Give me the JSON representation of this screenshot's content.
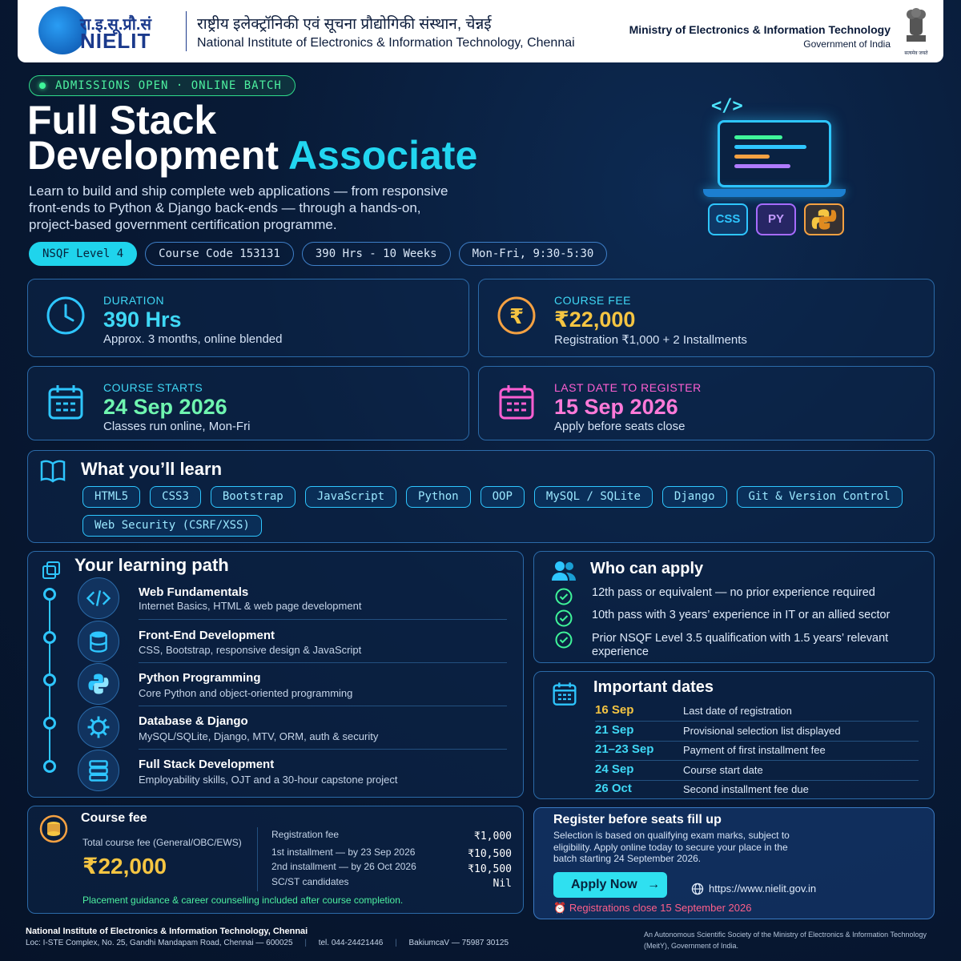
{
  "header": {
    "logo_devanagari": "रा.इ.सू.प्रौ.सं",
    "logo_word": "NIELIT",
    "title_hindi": "राष्ट्रीय इलेक्ट्रॉनिकी एवं सूचना प्रौद्योगिकी संस्थान, चेन्नई",
    "title_english": "National Institute of Electronics & Information Technology, Chennai",
    "ministry": "Ministry of Electronics & Information Technology",
    "government": "Government of India",
    "emblem_motto": "सत्यमेव जयते"
  },
  "hero": {
    "admissions": "ADMISSIONS OPEN · ONLINE BATCH",
    "title_line1": "Full Stack",
    "title_line2": "Development",
    "title_accent": "Associate",
    "intro": "Learn to build and ship complete web applications — from responsive front-ends to Python & Django back-ends — through a hands-on, project-based government certification programme.",
    "chips": [
      "NSQF Level 4",
      "Course Code  153131",
      "390 Hrs  -  10 Weeks",
      "Mon-Fri,  9:30-5:30"
    ],
    "code_symbol": "</>",
    "badges": [
      "CSS",
      "PY"
    ]
  },
  "stats": {
    "duration": {
      "label": "DURATION",
      "value": "390 Hrs",
      "sub": "Approx. 3 months, online blended"
    },
    "fee": {
      "label": "COURSE FEE",
      "value": "₹22,000",
      "sub": "Registration ₹1,000 + 2 Installments",
      "symbol": "₹"
    },
    "starts": {
      "label": "COURSE STARTS",
      "value": "24 Sep 2026",
      "sub": "Classes run online, Mon-Fri"
    },
    "last_date": {
      "label": "LAST DATE TO REGISTER",
      "value": "15 Sep 2026",
      "sub": "Apply before seats close"
    }
  },
  "learn": {
    "title": "What you’ll learn",
    "skills": [
      "HTML5",
      "CSS3",
      "Bootstrap",
      "JavaScript",
      "Python",
      "OOP",
      "MySQL / SQLite",
      "Django",
      "Git & Version Control",
      "Web Security (CSRF/XSS)"
    ]
  },
  "path": {
    "title": "Your learning path",
    "steps": [
      {
        "title": "Web Fundamentals",
        "desc": "Internet Basics, HTML & web page development",
        "icon": "code-icon"
      },
      {
        "title": "Front-End Development",
        "desc": "CSS, Bootstrap, responsive design & JavaScript",
        "icon": "database-icon"
      },
      {
        "title": "Python Programming",
        "desc": "Core Python and object-oriented programming",
        "icon": "python-icon"
      },
      {
        "title": "Database & Django",
        "desc": "MySQL/SQLite, Django, MTV, ORM, auth & security",
        "icon": "gear-icon"
      },
      {
        "title": "Full Stack Development",
        "desc": "Employability skills, OJT and a 30-hour capstone project",
        "icon": "server-icon"
      }
    ]
  },
  "apply": {
    "title": "Who can apply",
    "items": [
      "12th pass or equivalent — no prior experience required",
      "10th pass with 3 years’ experience in IT or an allied sector",
      "Prior NSQF Level 3.5 qualification with 1.5 years’ relevant experience"
    ]
  },
  "dates": {
    "title": "Important dates",
    "rows": [
      {
        "day": "16 Sep",
        "event": "Last date of registration"
      },
      {
        "day": "21 Sep",
        "event": "Provisional selection list displayed"
      },
      {
        "day": "21–23 Sep",
        "event": "Payment of first installment fee"
      },
      {
        "day": "24 Sep",
        "event": "Course start date"
      },
      {
        "day": "26 Oct",
        "event": "Second installment fee due"
      }
    ]
  },
  "fee_box": {
    "title": "Course fee",
    "total_label": "Total course fee (General/OBC/EWS)",
    "total": "₹22,000",
    "rows": [
      {
        "label": "Registration fee",
        "amount": "₹1,000"
      },
      {
        "label": "1st installment — by 23 Sep 2026",
        "amount": "₹10,500"
      },
      {
        "label": "2nd installment — by 26 Oct 2026",
        "amount": "₹10,500"
      },
      {
        "label": "SC/ST candidates",
        "amount": "Nil"
      }
    ],
    "note": "Placement guidance & career counselling included after course completion."
  },
  "register": {
    "title": "Register before seats fill up",
    "text": "Selection is based on qualifying exam marks, subject to eligibility. Apply online today to secure your place in the batch starting 24 September 2026.",
    "button": "Apply Now",
    "url": "https://www.nielit.gov.in",
    "closing": "Registrations close 15 September 2026"
  },
  "footer": {
    "name": "National Institute of Electronics & Information Technology, Chennai",
    "loc": "Loc: I-STE Complex, No. 25, Gandhi Mandapam Road, Chennai — 600025",
    "tel": "tel. 044-24421446",
    "mobile": "BakiumcaV — 75987 30125",
    "right": "An Autonomous Scientific Society of the Ministry of Electronics & Information Technology (MeitY), Government of India."
  },
  "colors": {
    "accent": "#22d6f0",
    "green": "#4df0a0",
    "pink": "#ff5fd2",
    "gold": "#f5c542"
  }
}
